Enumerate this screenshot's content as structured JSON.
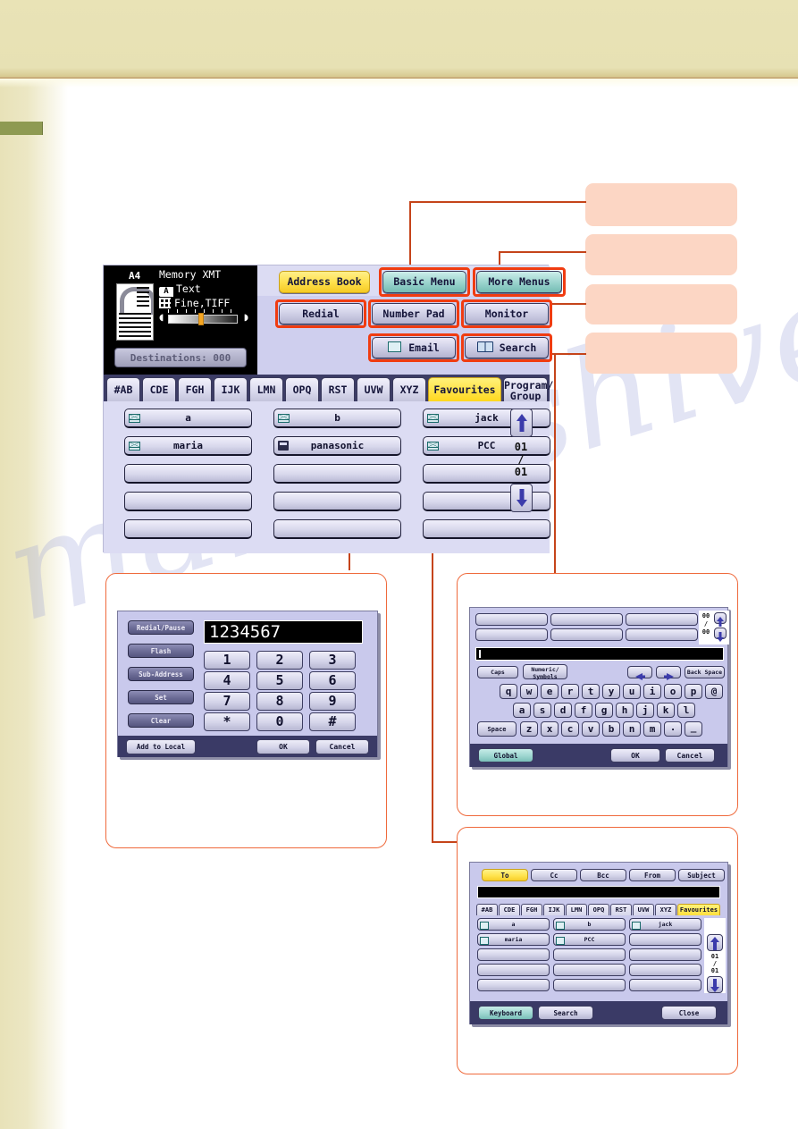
{
  "page": {
    "watermark_text": "manualshive.com"
  },
  "fax_panel": {
    "status": {
      "paper_size": "A4",
      "mode": "Memory XMT",
      "original_type": "Text",
      "resolution": "Fine,TIFF",
      "destinations_label": "Destinations: 000",
      "doc_icon": "document-preview-icon",
      "text_icon": "text-mode-icon",
      "grid_icon": "resolution-grid-icon",
      "contrast_slider": "contrast-slider"
    },
    "top_buttons": [
      {
        "label": "Address Book",
        "style": "yellow",
        "highlight": false
      },
      {
        "label": "Basic Menu",
        "style": "teal",
        "highlight": true
      },
      {
        "label": "More Menus",
        "style": "teal",
        "highlight": true
      }
    ],
    "mid_buttons": [
      {
        "label": "Redial",
        "style": "plain",
        "highlight": true
      },
      {
        "label": "Number Pad",
        "style": "plain",
        "highlight": true
      },
      {
        "label": "Monitor",
        "style": "plain",
        "highlight": true
      }
    ],
    "low_buttons": [
      {
        "label": "Email",
        "style": "plain",
        "highlight": true,
        "icon": "envelope-icon"
      },
      {
        "label": "Search",
        "style": "plain",
        "highlight": true,
        "icon": "address-book-icon"
      }
    ],
    "tabs": [
      {
        "label": "#AB",
        "selected": false
      },
      {
        "label": "CDE",
        "selected": false
      },
      {
        "label": "FGH",
        "selected": false
      },
      {
        "label": "IJK",
        "selected": false
      },
      {
        "label": "LMN",
        "selected": false
      },
      {
        "label": "OPQ",
        "selected": false
      },
      {
        "label": "RST",
        "selected": false
      },
      {
        "label": "UVW",
        "selected": false
      },
      {
        "label": "XYZ",
        "selected": false
      },
      {
        "label": "Favourites",
        "selected": true
      },
      {
        "label": "Program/",
        "label2": "Group",
        "selected": false
      }
    ],
    "entries": [
      {
        "label": "a",
        "icon": "envelope-icon"
      },
      {
        "label": "b",
        "icon": "envelope-icon"
      },
      {
        "label": "jack",
        "icon": "envelope-icon"
      },
      {
        "label": "maria",
        "icon": "envelope-icon"
      },
      {
        "label": "panasonic",
        "icon": "fax-icon"
      },
      {
        "label": "PCC",
        "icon": "envelope-icon"
      },
      {
        "label": "",
        "icon": ""
      },
      {
        "label": "",
        "icon": ""
      },
      {
        "label": "",
        "icon": ""
      },
      {
        "label": "",
        "icon": ""
      },
      {
        "label": "",
        "icon": ""
      },
      {
        "label": "",
        "icon": ""
      },
      {
        "label": "",
        "icon": ""
      },
      {
        "label": "",
        "icon": ""
      },
      {
        "label": "",
        "icon": ""
      }
    ],
    "pager": {
      "current": "01",
      "separator": "/",
      "total": "01",
      "up_icon": "arrow-up-icon",
      "down_icon": "arrow-down-icon"
    }
  },
  "callouts": [
    {
      "id": "callout-basic-menu"
    },
    {
      "id": "callout-more-menus"
    },
    {
      "id": "callout-monitor"
    },
    {
      "id": "callout-search"
    }
  ],
  "keypad_dialog": {
    "display_value": "1234567",
    "side_buttons": [
      "Redial/Pause",
      "Flash",
      "Sub-Address",
      "Set",
      "Clear"
    ],
    "keys": [
      "1",
      "2",
      "3",
      "4",
      "5",
      "6",
      "7",
      "8",
      "9",
      "*",
      "0",
      "#"
    ],
    "footer": {
      "add": "Add to Local",
      "ok": "OK",
      "cancel": "Cancel"
    }
  },
  "keyboard_dialog": {
    "slot_count": 6,
    "pager": {
      "current": "00",
      "separator": "/",
      "total": "00",
      "up_icon": "arrow-up-icon",
      "down_icon": "arrow-down-icon"
    },
    "input_value": "",
    "tool_row": {
      "caps": "Caps",
      "numeric": "Numeric/",
      "numeric2": "Symbols",
      "left_icon": "arrow-left-icon",
      "right_icon": "arrow-right-icon",
      "back_space": "Back Space"
    },
    "row1": [
      "q",
      "w",
      "e",
      "r",
      "t",
      "y",
      "u",
      "i",
      "o",
      "p",
      "@"
    ],
    "row2": [
      "a",
      "s",
      "d",
      "f",
      "g",
      "h",
      "j",
      "k",
      "l"
    ],
    "row3_space": "Space",
    "row3": [
      "z",
      "x",
      "c",
      "v",
      "b",
      "n",
      "m",
      ".",
      "_"
    ],
    "footer": {
      "global": "Global",
      "ok": "OK",
      "cancel": "Cancel"
    }
  },
  "email_dialog": {
    "field_tabs": [
      {
        "label": "To",
        "selected": true
      },
      {
        "label": "Cc",
        "selected": false
      },
      {
        "label": "Bcc",
        "selected": false
      },
      {
        "label": "From",
        "selected": false
      },
      {
        "label": "Subject",
        "selected": false
      }
    ],
    "input_value": "",
    "tabs": [
      {
        "label": "#AB",
        "selected": false
      },
      {
        "label": "CDE",
        "selected": false
      },
      {
        "label": "FGH",
        "selected": false
      },
      {
        "label": "IJK",
        "selected": false
      },
      {
        "label": "LMN",
        "selected": false
      },
      {
        "label": "OPQ",
        "selected": false
      },
      {
        "label": "RST",
        "selected": false
      },
      {
        "label": "UVW",
        "selected": false
      },
      {
        "label": "XYZ",
        "selected": false
      },
      {
        "label": "Favourites",
        "selected": true
      }
    ],
    "entries": [
      {
        "label": "a",
        "icon": "envelope-icon"
      },
      {
        "label": "b",
        "icon": "envelope-icon"
      },
      {
        "label": "jack",
        "icon": "envelope-icon"
      },
      {
        "label": "maria",
        "icon": "envelope-icon"
      },
      {
        "label": "PCC",
        "icon": "envelope-icon"
      },
      {
        "label": "",
        "icon": ""
      },
      {
        "label": "",
        "icon": ""
      },
      {
        "label": "",
        "icon": ""
      },
      {
        "label": "",
        "icon": ""
      },
      {
        "label": "",
        "icon": ""
      },
      {
        "label": "",
        "icon": ""
      },
      {
        "label": "",
        "icon": ""
      },
      {
        "label": "",
        "icon": ""
      },
      {
        "label": "",
        "icon": ""
      },
      {
        "label": "",
        "icon": ""
      }
    ],
    "pager": {
      "current": "01",
      "separator": "/",
      "total": "01",
      "up_icon": "arrow-up-icon",
      "down_icon": "arrow-down-icon"
    },
    "footer": {
      "keyboard": "Keyboard",
      "search": "Search",
      "close": "Close"
    }
  },
  "colors": {
    "highlight_border": "#f03c11",
    "callout_fill": "#fcd6c4",
    "callout_line": "#c5441a",
    "lcd_bg": "#dcdcf3",
    "selected_tab": "#ffe243",
    "teal_button": "#9fd6d0",
    "header_band": "#e9e3b6"
  }
}
